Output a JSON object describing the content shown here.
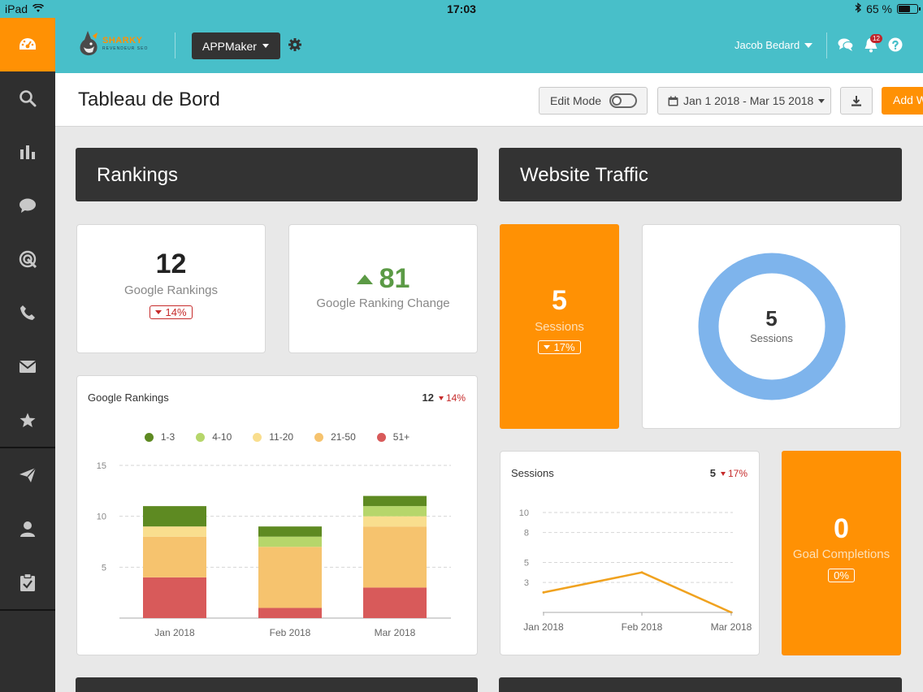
{
  "status_bar": {
    "device": "iPad",
    "time": "17:03",
    "battery": "65 %",
    "battery_level": 0.65
  },
  "sidebar": {
    "items": [
      {
        "icon": "dashboard-icon"
      },
      {
        "icon": "search-icon"
      },
      {
        "icon": "bar-chart-icon"
      },
      {
        "icon": "chat-icon"
      },
      {
        "icon": "target-icon"
      },
      {
        "icon": "phone-icon"
      },
      {
        "icon": "mail-icon"
      },
      {
        "icon": "star-icon"
      },
      {
        "icon": "send-icon"
      },
      {
        "icon": "user-icon"
      },
      {
        "icon": "clipboard-icon"
      }
    ]
  },
  "header": {
    "logo_text": "SHARKY",
    "logo_sub": "REVENDEUR SEO",
    "app_selector": "APPMaker",
    "user": "Jacob Bedard",
    "notifications": "12"
  },
  "page": {
    "title": "Tableau de Bord",
    "edit_mode": "Edit Mode",
    "date_range": "Jan 1 2018 - Mar 15 2018",
    "add_button": "Add W"
  },
  "rankings": {
    "section_title": "Rankings",
    "google_rankings": {
      "value": "12",
      "label": "Google Rankings",
      "delta": "14%"
    },
    "ranking_change": {
      "value": "81",
      "label": "Google Ranking Change"
    },
    "chart": {
      "title": "Google Rankings",
      "metric": "12",
      "delta": "14%"
    }
  },
  "traffic": {
    "section_title": "Website Traffic",
    "sessions": {
      "value": "5",
      "label": "Sessions",
      "delta": "17%"
    },
    "donut": {
      "value": "5",
      "label": "Sessions",
      "color": "#7eb4ec"
    },
    "sessions_chart": {
      "title": "Sessions",
      "metric": "5",
      "delta": "17%"
    },
    "goals": {
      "value": "0",
      "label": "Goal Completions",
      "delta": "0%"
    }
  },
  "chart_data": [
    {
      "type": "bar",
      "title": "Google Rankings",
      "stacked": true,
      "categories": [
        "Jan 2018",
        "Feb 2018",
        "Mar 2018"
      ],
      "yticks": [
        5,
        10,
        15
      ],
      "ylim": [
        0,
        16
      ],
      "legend_position": "top",
      "series": [
        {
          "name": "1-3",
          "color": "#5e8a22",
          "values": [
            2,
            1,
            1
          ]
        },
        {
          "name": "4-10",
          "color": "#b6d66b",
          "values": [
            0,
            1,
            1
          ]
        },
        {
          "name": "11-20",
          "color": "#f9de8e",
          "values": [
            1,
            0,
            1
          ]
        },
        {
          "name": "21-50",
          "color": "#f6c36e",
          "values": [
            4,
            6,
            6
          ]
        },
        {
          "name": "51+",
          "color": "#d85a5a",
          "values": [
            4,
            1,
            3
          ]
        }
      ]
    },
    {
      "type": "line",
      "title": "Sessions",
      "x": [
        "Jan 2018",
        "Feb 2018",
        "Mar 2018"
      ],
      "yticks": [
        3,
        5,
        8,
        10
      ],
      "ylim": [
        0,
        11
      ],
      "series": [
        {
          "name": "Sessions",
          "color": "#f0a21f",
          "values": [
            2,
            4,
            0
          ]
        }
      ]
    }
  ]
}
